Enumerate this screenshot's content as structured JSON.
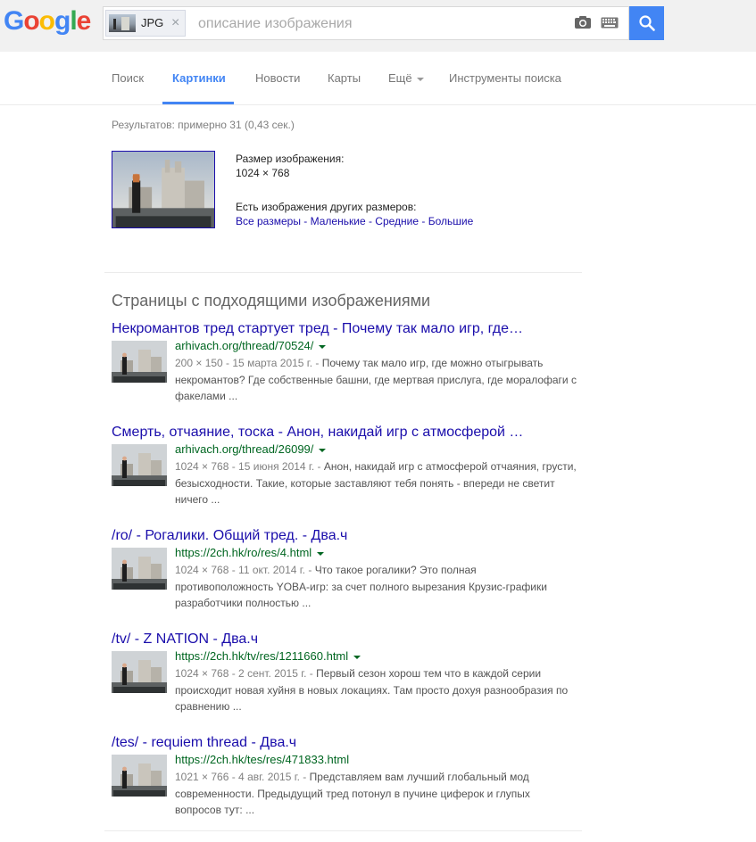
{
  "logo": {
    "text": "Google",
    "letters": [
      "G",
      "o",
      "o",
      "g",
      "l",
      "e"
    ],
    "colors": [
      "#4285f4",
      "#ea4335",
      "#fbbc05",
      "#4285f4",
      "#34a853",
      "#ea4335"
    ]
  },
  "search": {
    "chip_label": "JPG",
    "chip_close": "×",
    "placeholder": "описание изображения",
    "value": "",
    "icons": [
      "camera-icon",
      "keyboard-icon",
      "search-icon"
    ],
    "button_color": "#4285f4"
  },
  "nav": {
    "tabs": [
      {
        "label": "Поиск",
        "active": false
      },
      {
        "label": "Картинки",
        "active": true
      },
      {
        "label": "Новости",
        "active": false
      },
      {
        "label": "Карты",
        "active": false
      },
      {
        "label": "Ещё",
        "active": false,
        "dropdown": true
      },
      {
        "label": "Инструменты поиска",
        "active": false
      }
    ]
  },
  "result_stats": "Результатов: примерно 31 (0,43 сек.)",
  "image_info": {
    "size_label": "Размер изображения:",
    "size_value": "1024 × 768",
    "other_sizes_label": "Есть изображения других размеров:",
    "links": [
      "Все размеры",
      "Маленькие",
      "Средние",
      "Большие"
    ],
    "separator": " - "
  },
  "section_title": "Страницы с подходящими изображениями",
  "results": [
    {
      "title": "Некромантов тред стартует тред - Почему так мало игр, где…",
      "url": "arhivach.org/thread/70524/",
      "meta": "200 × 150 - 15 марта 2015 г. - ",
      "snippet": "Почему так мало игр, где можно отыгрывать некромантов? Где собственные башни, где мертвая прислуга, где моралофаги с факелами ..."
    },
    {
      "title": "Смерть, отчаяние, тоска - Анон, накидай игр с атмосферой …",
      "url": "arhivach.org/thread/26099/",
      "meta": "1024 × 768 - 15 июня 2014 г. - ",
      "snippet": "Анон, накидай игр с атмосферой отчаяния, грусти, безысходности. Такие, которые заставляют тебя понять - впереди не светит ничего ..."
    },
    {
      "title": "/ro/ - Рогалики. Общий тред. - Два.ч",
      "url": "https://2ch.hk/ro/res/4.html",
      "meta": "1024 × 768 - 11 окт. 2014 г. - ",
      "snippet": "Что такое рогалики? Это полная противоположность YOBA-игр: за счет полного вырезания Крузис-графики разработчики полностью ..."
    },
    {
      "title": "/tv/ - Z NATION - Два.ч",
      "url": "https://2ch.hk/tv/res/1211660.html",
      "meta": "1024 × 768 - 2 сент. 2015 г. - ",
      "snippet": "Первый сезон хорош тем что в каждой серии происходит новая хуйня в новых локациях. Там просто дохуя разнообразия по сравнению ..."
    },
    {
      "title": "/tes/ - requiem thread - Два.ч",
      "url": "https://2ch.hk/tes/res/471833.html",
      "meta": "1021 × 766 - 4 авг. 2015 г. - ",
      "snippet": "Представляем вам лучший глобальный мод современности. Предыдущий тред потонул в пучине циферок и глупых вопросов тут: ..."
    }
  ],
  "colors": {
    "link": "#1a0dab",
    "url": "#006621",
    "accent": "#4285f4",
    "snippet": "#545454",
    "meta": "#808080"
  }
}
